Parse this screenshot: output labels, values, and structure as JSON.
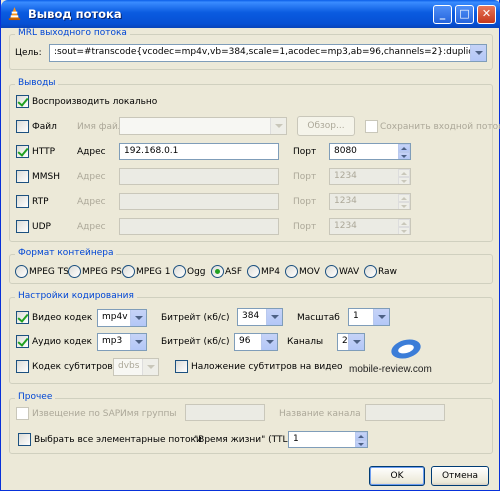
{
  "window": {
    "title": "Вывод потока",
    "minimize": "_",
    "maximize": "□",
    "close": "✕"
  },
  "mrl": {
    "group_title": "MRL выходного потока",
    "target_label": "Цель:",
    "target_value": ":sout=#transcode{vcodec=mp4v,vb=384,scale=1,acodec=mp3,ab=96,channels=2}:duplicate{dst=display"
  },
  "outputs": {
    "group_title": "Выводы",
    "play_locally": "Воспроизводить локально",
    "file": {
      "label": "Файл",
      "name_label": "Имя файла",
      "browse": "Обзор...",
      "keep_input": "Сохранить входной поток"
    },
    "http": {
      "label": "HTTP",
      "address_label": "Адрес",
      "address": "192.168.0.1",
      "port_label": "Порт",
      "port": "8080"
    },
    "mmsh": {
      "label": "MMSH",
      "address_label": "Адрес",
      "port_label": "Порт",
      "port": "1234"
    },
    "rtp": {
      "label": "RTP",
      "address_label": "Адрес",
      "port_label": "Порт",
      "port": "1234"
    },
    "udp": {
      "label": "UDP",
      "address_label": "Адрес",
      "port_label": "Порт",
      "port": "1234"
    }
  },
  "container": {
    "group_title": "Формат контейнера",
    "options": [
      "MPEG TS",
      "MPEG PS",
      "MPEG 1",
      "Ogg",
      "ASF",
      "MP4",
      "MOV",
      "WAV",
      "Raw"
    ],
    "selected": "ASF"
  },
  "encoding": {
    "group_title": "Настройки кодирования",
    "video_codec": {
      "label": "Видео кодек",
      "value": "mp4v",
      "bitrate_label": "Битрейт (кб/с)",
      "bitrate": "384",
      "scale_label": "Масштаб",
      "scale": "1"
    },
    "audio_codec": {
      "label": "Аудио кодек",
      "value": "mp3",
      "bitrate_label": "Битрейт (кб/с)",
      "bitrate": "96",
      "channels_label": "Каналы",
      "channels": "2"
    },
    "subtitles": {
      "label": "Кодек субтитров",
      "value": "dvbs",
      "overlay": "Наложение субтитров на видео"
    }
  },
  "watermark": "mobile-review.com",
  "misc": {
    "group_title": "Прочее",
    "sap": "Извещение по SAP",
    "group_name": "Имя группы",
    "channel_name": "Название канала",
    "all_es": "Выбрать все элементарные потоки",
    "ttl_label": "\"Время жизни\" (TTL)",
    "ttl": "1"
  },
  "buttons": {
    "ok": "OK",
    "cancel": "Отмена"
  },
  "colors": {
    "titlebar": "#0a5be0",
    "face": "#ece9d8",
    "group_title": "#0046d5",
    "check": "#21a121"
  }
}
